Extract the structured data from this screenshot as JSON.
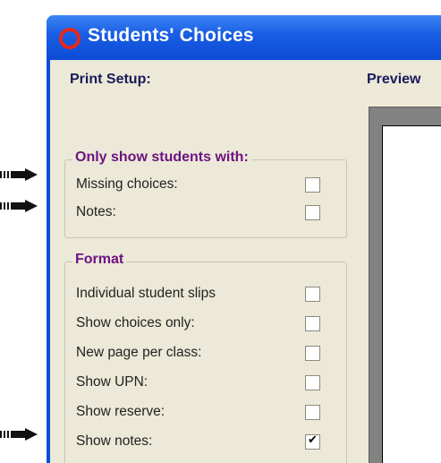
{
  "window": {
    "title": "Students' Choices"
  },
  "print_setup": {
    "heading": "Print Setup:"
  },
  "preview": {
    "heading": "Preview"
  },
  "filter_group": {
    "title": "Only show students with:",
    "items": [
      {
        "label": "Missing choices:",
        "checked": false
      },
      {
        "label": "Notes:",
        "checked": false
      }
    ]
  },
  "format_group": {
    "title": "Format",
    "items": [
      {
        "label": "Individual student slips",
        "checked": false
      },
      {
        "label": "Show choices only:",
        "checked": false
      },
      {
        "label": "New page per class:",
        "checked": false
      },
      {
        "label": "Show UPN:",
        "checked": false
      },
      {
        "label": "Show reserve:",
        "checked": false
      },
      {
        "label": "Show notes:",
        "checked": true
      }
    ]
  }
}
